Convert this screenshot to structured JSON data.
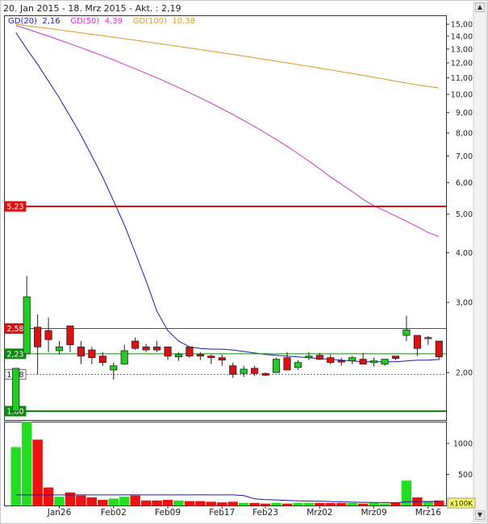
{
  "header": {
    "title": "20. Jan 2015 - 18. Mrz 2015 - Akt. : 2,19"
  },
  "legend": [
    {
      "label": "GD(20)",
      "value": "2,16",
      "color": "#1a1aaa"
    },
    {
      "label": "GD(50)",
      "value": "4,39",
      "color": "#cc33cc"
    },
    {
      "label": "GD(100)",
      "value": "10,38",
      "color": "#dd9922"
    }
  ],
  "chart_data": {
    "type": "candlestick",
    "title": "20. Jan 2015 - 18. Mrz 2015 - Akt. : 2,19",
    "x_ticks": [
      "Jan26",
      "Feb02",
      "Feb09",
      "Feb17",
      "Feb23",
      "Mrz02",
      "Mrz09",
      "Mrz16"
    ],
    "y_ticks": [
      "15,00",
      "14,00",
      "13,00",
      "12,00",
      "11,00",
      "10,00",
      "9,00",
      "8,00",
      "7,00",
      "6,00",
      "5,00",
      "4,00",
      "3,00",
      "2,00"
    ],
    "y_scale": "log",
    "y_range": [
      1.52,
      15.8
    ],
    "volume_ticks": [
      "1000",
      "500"
    ],
    "volume_unit": "x100K",
    "volume_range": [
      0,
      1350
    ],
    "reference_lines": [
      {
        "label": "5,23",
        "value": 5.23,
        "color": "#dd1111"
      },
      {
        "label": "2,58",
        "value": 2.58,
        "color": "#dd1111"
      },
      {
        "label": "2,23",
        "value": 2.23,
        "color": "#118811"
      },
      {
        "label": "1,98",
        "value": 1.98,
        "color": "#666666"
      },
      {
        "label": "1,60",
        "value": 1.6,
        "color": "#118811"
      }
    ],
    "candles": [
      {
        "o": 1.6,
        "h": 2.05,
        "l": 1.6,
        "c": 2.05
      },
      {
        "o": 2.23,
        "h": 3.5,
        "l": 2.23,
        "c": 3.1
      },
      {
        "o": 2.6,
        "h": 2.8,
        "l": 1.98,
        "c": 2.32
      },
      {
        "o": 2.55,
        "h": 2.75,
        "l": 2.25,
        "c": 2.42
      },
      {
        "o": 2.27,
        "h": 2.4,
        "l": 2.22,
        "c": 2.32
      },
      {
        "o": 2.62,
        "h": 2.62,
        "l": 2.25,
        "c": 2.35
      },
      {
        "o": 2.32,
        "h": 2.4,
        "l": 2.1,
        "c": 2.2
      },
      {
        "o": 2.28,
        "h": 2.32,
        "l": 2.1,
        "c": 2.18
      },
      {
        "o": 2.2,
        "h": 2.25,
        "l": 2.08,
        "c": 2.12
      },
      {
        "o": 2.03,
        "h": 2.12,
        "l": 1.92,
        "c": 2.08
      },
      {
        "o": 2.1,
        "h": 2.35,
        "l": 2.1,
        "c": 2.27
      },
      {
        "o": 2.4,
        "h": 2.45,
        "l": 2.28,
        "c": 2.3
      },
      {
        "o": 2.32,
        "h": 2.36,
        "l": 2.25,
        "c": 2.28
      },
      {
        "o": 2.32,
        "h": 2.4,
        "l": 2.25,
        "c": 2.28
      },
      {
        "o": 2.32,
        "h": 2.32,
        "l": 2.15,
        "c": 2.2
      },
      {
        "o": 2.19,
        "h": 2.25,
        "l": 2.14,
        "c": 2.22
      },
      {
        "o": 2.32,
        "h": 2.32,
        "l": 2.18,
        "c": 2.2
      },
      {
        "o": 2.22,
        "h": 2.25,
        "l": 2.15,
        "c": 2.2
      },
      {
        "o": 2.2,
        "h": 2.22,
        "l": 2.1,
        "c": 2.18
      },
      {
        "o": 2.18,
        "h": 2.22,
        "l": 2.08,
        "c": 2.15
      },
      {
        "o": 2.08,
        "h": 2.12,
        "l": 1.94,
        "c": 1.98
      },
      {
        "o": 1.99,
        "h": 2.08,
        "l": 1.95,
        "c": 2.04
      },
      {
        "o": 2.05,
        "h": 2.08,
        "l": 1.96,
        "c": 1.99
      },
      {
        "o": 1.99,
        "h": 2.0,
        "l": 1.96,
        "c": 1.97
      },
      {
        "o": 2.0,
        "h": 2.18,
        "l": 2.0,
        "c": 2.16
      },
      {
        "o": 2.18,
        "h": 2.25,
        "l": 2.05,
        "c": 2.03
      },
      {
        "o": 2.06,
        "h": 2.15,
        "l": 2.03,
        "c": 2.12
      },
      {
        "o": 2.18,
        "h": 2.25,
        "l": 2.15,
        "c": 2.2
      },
      {
        "o": 2.21,
        "h": 2.24,
        "l": 2.15,
        "c": 2.16
      },
      {
        "o": 2.18,
        "h": 2.22,
        "l": 2.1,
        "c": 2.12
      },
      {
        "o": 2.14,
        "h": 2.18,
        "l": 2.08,
        "c": 2.13
      },
      {
        "o": 2.14,
        "h": 2.2,
        "l": 2.1,
        "c": 2.18
      },
      {
        "o": 2.16,
        "h": 2.24,
        "l": 2.1,
        "c": 2.1
      },
      {
        "o": 2.12,
        "h": 2.18,
        "l": 2.07,
        "c": 2.14
      },
      {
        "o": 2.1,
        "h": 2.15,
        "l": 2.08,
        "c": 2.16
      },
      {
        "o": 2.2,
        "h": 2.2,
        "l": 2.15,
        "c": 2.17
      },
      {
        "o": 2.48,
        "h": 2.78,
        "l": 2.4,
        "c": 2.56
      },
      {
        "o": 2.48,
        "h": 2.48,
        "l": 2.2,
        "c": 2.3
      },
      {
        "o": 2.45,
        "h": 2.47,
        "l": 2.35,
        "c": 2.45
      },
      {
        "o": 2.4,
        "h": 2.4,
        "l": 2.15,
        "c": 2.19
      }
    ],
    "volume": [
      940,
      1350,
      1060,
      290,
      140,
      210,
      160,
      130,
      90,
      110,
      140,
      160,
      80,
      80,
      90,
      80,
      70,
      70,
      60,
      50,
      60,
      40,
      40,
      30,
      40,
      30,
      40,
      40,
      40,
      40,
      40,
      40,
      30,
      40,
      30,
      40,
      400,
      130,
      70,
      80
    ],
    "series": [
      {
        "name": "GD(20)",
        "color": "#1a1aaa",
        "values": [
          14.3,
          13.0,
          11.9,
          10.8,
          9.8,
          8.8,
          7.9,
          7.0,
          6.2,
          5.4,
          4.7,
          4.0,
          3.4,
          2.85,
          2.55,
          2.4,
          2.32,
          2.3,
          2.29,
          2.29,
          2.28,
          2.26,
          2.24,
          2.22,
          2.21,
          2.2,
          2.19,
          2.18,
          2.17,
          2.16,
          2.15,
          2.14,
          2.13,
          2.13,
          2.13,
          2.13,
          2.14,
          2.15,
          2.15,
          2.16
        ]
      },
      {
        "name": "GD(50)",
        "color": "#cc33cc",
        "values": [
          14.9,
          14.6,
          14.3,
          14.0,
          13.7,
          13.4,
          13.1,
          12.8,
          12.5,
          12.2,
          11.9,
          11.6,
          11.3,
          11.0,
          10.7,
          10.4,
          10.1,
          9.8,
          9.5,
          9.2,
          8.9,
          8.6,
          8.3,
          8.0,
          7.7,
          7.4,
          7.1,
          6.8,
          6.5,
          6.2,
          5.95,
          5.7,
          5.45,
          5.25,
          5.1,
          4.95,
          4.8,
          4.65,
          4.5,
          4.39
        ]
      },
      {
        "name": "GD(100)",
        "color": "#dd9922",
        "values": [
          15.0,
          14.88,
          14.76,
          14.64,
          14.52,
          14.4,
          14.28,
          14.16,
          14.04,
          13.92,
          13.8,
          13.68,
          13.56,
          13.44,
          13.32,
          13.2,
          13.08,
          12.96,
          12.84,
          12.72,
          12.6,
          12.48,
          12.36,
          12.24,
          12.12,
          12.0,
          11.88,
          11.76,
          11.64,
          11.52,
          11.4,
          11.28,
          11.16,
          11.04,
          10.92,
          10.8,
          10.68,
          10.56,
          10.47,
          10.38
        ]
      }
    ]
  }
}
